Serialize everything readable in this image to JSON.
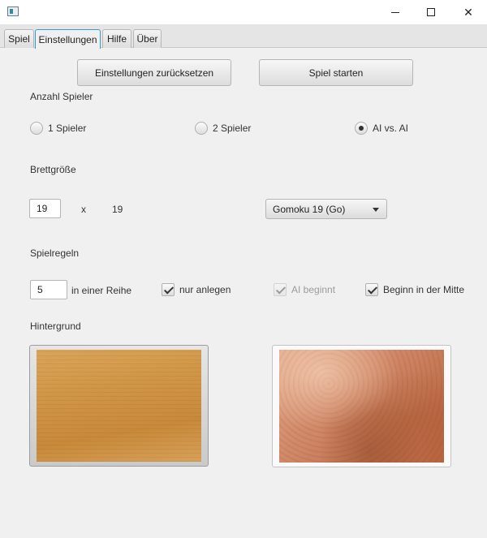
{
  "window": {
    "icon": "app-icon",
    "controls": {
      "minimize": "minimize-icon",
      "maximize": "maximize-icon",
      "close": "✕"
    }
  },
  "tabs": [
    "Spiel",
    "Einstellungen",
    "Hilfe",
    "Über"
  ],
  "active_tab": "Einstellungen",
  "toolbar": {
    "reset_label": "Einstellungen zurücksetzen",
    "start_label": "Spiel starten"
  },
  "players": {
    "heading": "Anzahl Spieler",
    "options": [
      "1 Spieler",
      "2 Spieler",
      "AI vs. AI"
    ],
    "selected": "AI vs. AI"
  },
  "board": {
    "heading": "Brettgröße",
    "width_value": "19",
    "separator": "x",
    "height_value": "19",
    "preset_selected": "Gomoku 19 (Go)"
  },
  "rules": {
    "heading": "Spielregeln",
    "row_count_value": "5",
    "row_count_suffix": "in einer Reihe",
    "checkboxes": [
      {
        "label": "nur anlegen",
        "checked": true,
        "enabled": true
      },
      {
        "label": "AI beginnt",
        "checked": true,
        "enabled": false
      },
      {
        "label": "Beginn in der Mitte",
        "checked": true,
        "enabled": true
      }
    ]
  },
  "background": {
    "heading": "Hintergrund",
    "options": [
      "light-wood",
      "burl-wood"
    ],
    "selected": "light-wood"
  },
  "colors": {
    "tab_focus": "#3b98d6",
    "window_bg": "#f0f0f0"
  }
}
